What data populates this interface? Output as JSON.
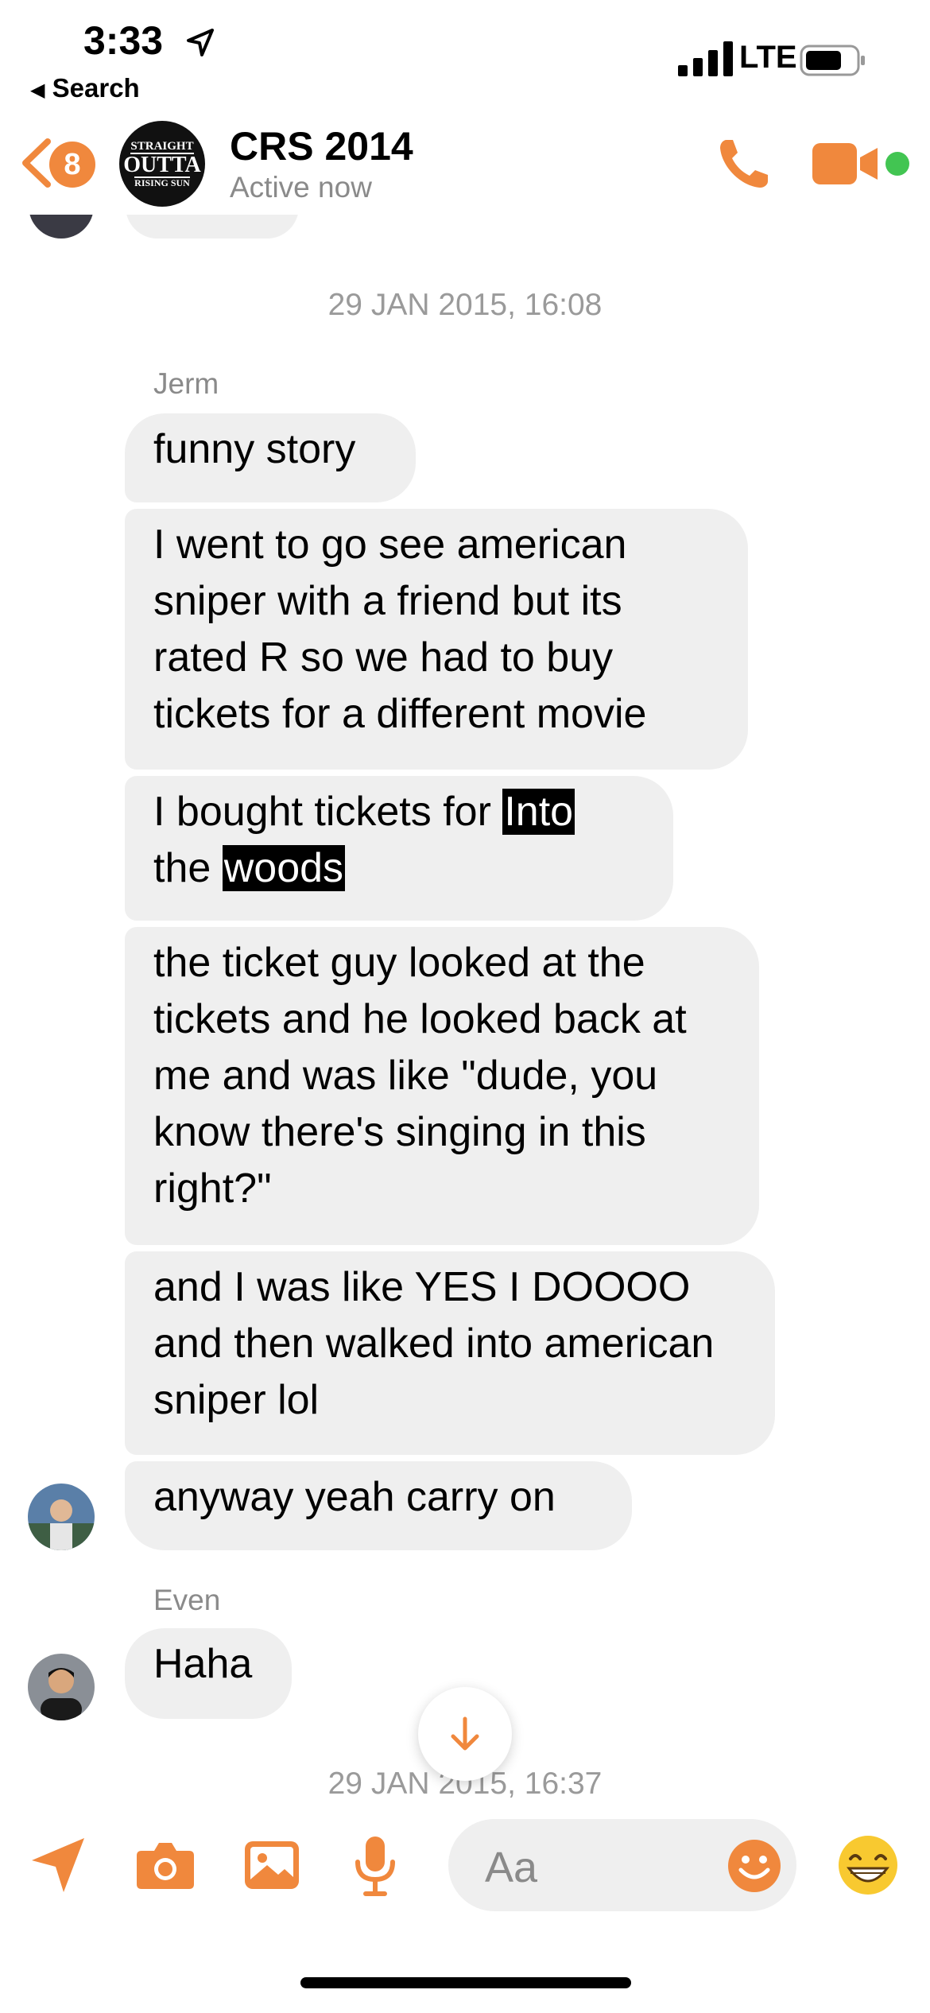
{
  "status_bar": {
    "time": "3:33",
    "back_label": "Search",
    "network": "LTE"
  },
  "header": {
    "badge_count": "8",
    "chat_name": "CRS 2014",
    "status": "Active now",
    "avatar_lines": [
      "STRAIGHT",
      "OUTTA",
      "RISING SUN"
    ]
  },
  "messages": {
    "date1": "29 JAN 2015, 16:08",
    "sender1": "Jerm",
    "m1": "funny story",
    "m2": "I went to go see american sniper with a friend but its rated R so we had to buy tickets for a different movie",
    "m3_pre": "I bought tickets for ",
    "m3_hl1": "Into",
    "m3_mid": "the ",
    "m3_hl2": "woods",
    "m4": "the ticket guy looked at the tickets and he looked back at me and was like \"dude, you know there's singing in this right?\"",
    "m5": "and I was like YES I DOOOO and then walked into american sniper lol",
    "m6": "anyway yeah carry on",
    "sender2": "Even",
    "m7": "Haha",
    "date2": "29 JAN 2015, 16:37"
  },
  "composer": {
    "placeholder": "Aa"
  },
  "colors": {
    "accent": "#f0883d",
    "bubble": "#efefef",
    "online": "#42c552"
  }
}
